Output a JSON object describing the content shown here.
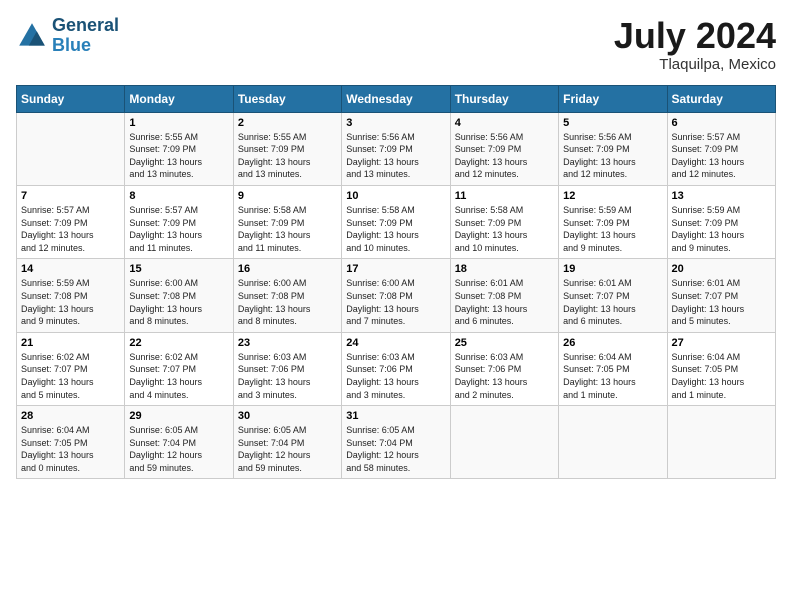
{
  "header": {
    "logo_line1": "General",
    "logo_line2": "Blue",
    "month": "July 2024",
    "location": "Tlaquilpa, Mexico"
  },
  "days_of_week": [
    "Sunday",
    "Monday",
    "Tuesday",
    "Wednesday",
    "Thursday",
    "Friday",
    "Saturday"
  ],
  "weeks": [
    [
      {
        "day": "",
        "info": ""
      },
      {
        "day": "1",
        "info": "Sunrise: 5:55 AM\nSunset: 7:09 PM\nDaylight: 13 hours\nand 13 minutes."
      },
      {
        "day": "2",
        "info": "Sunrise: 5:55 AM\nSunset: 7:09 PM\nDaylight: 13 hours\nand 13 minutes."
      },
      {
        "day": "3",
        "info": "Sunrise: 5:56 AM\nSunset: 7:09 PM\nDaylight: 13 hours\nand 13 minutes."
      },
      {
        "day": "4",
        "info": "Sunrise: 5:56 AM\nSunset: 7:09 PM\nDaylight: 13 hours\nand 12 minutes."
      },
      {
        "day": "5",
        "info": "Sunrise: 5:56 AM\nSunset: 7:09 PM\nDaylight: 13 hours\nand 12 minutes."
      },
      {
        "day": "6",
        "info": "Sunrise: 5:57 AM\nSunset: 7:09 PM\nDaylight: 13 hours\nand 12 minutes."
      }
    ],
    [
      {
        "day": "7",
        "info": "Sunrise: 5:57 AM\nSunset: 7:09 PM\nDaylight: 13 hours\nand 12 minutes."
      },
      {
        "day": "8",
        "info": "Sunrise: 5:57 AM\nSunset: 7:09 PM\nDaylight: 13 hours\nand 11 minutes."
      },
      {
        "day": "9",
        "info": "Sunrise: 5:58 AM\nSunset: 7:09 PM\nDaylight: 13 hours\nand 11 minutes."
      },
      {
        "day": "10",
        "info": "Sunrise: 5:58 AM\nSunset: 7:09 PM\nDaylight: 13 hours\nand 10 minutes."
      },
      {
        "day": "11",
        "info": "Sunrise: 5:58 AM\nSunset: 7:09 PM\nDaylight: 13 hours\nand 10 minutes."
      },
      {
        "day": "12",
        "info": "Sunrise: 5:59 AM\nSunset: 7:09 PM\nDaylight: 13 hours\nand 9 minutes."
      },
      {
        "day": "13",
        "info": "Sunrise: 5:59 AM\nSunset: 7:09 PM\nDaylight: 13 hours\nand 9 minutes."
      }
    ],
    [
      {
        "day": "14",
        "info": "Sunrise: 5:59 AM\nSunset: 7:08 PM\nDaylight: 13 hours\nand 9 minutes."
      },
      {
        "day": "15",
        "info": "Sunrise: 6:00 AM\nSunset: 7:08 PM\nDaylight: 13 hours\nand 8 minutes."
      },
      {
        "day": "16",
        "info": "Sunrise: 6:00 AM\nSunset: 7:08 PM\nDaylight: 13 hours\nand 8 minutes."
      },
      {
        "day": "17",
        "info": "Sunrise: 6:00 AM\nSunset: 7:08 PM\nDaylight: 13 hours\nand 7 minutes."
      },
      {
        "day": "18",
        "info": "Sunrise: 6:01 AM\nSunset: 7:08 PM\nDaylight: 13 hours\nand 6 minutes."
      },
      {
        "day": "19",
        "info": "Sunrise: 6:01 AM\nSunset: 7:07 PM\nDaylight: 13 hours\nand 6 minutes."
      },
      {
        "day": "20",
        "info": "Sunrise: 6:01 AM\nSunset: 7:07 PM\nDaylight: 13 hours\nand 5 minutes."
      }
    ],
    [
      {
        "day": "21",
        "info": "Sunrise: 6:02 AM\nSunset: 7:07 PM\nDaylight: 13 hours\nand 5 minutes."
      },
      {
        "day": "22",
        "info": "Sunrise: 6:02 AM\nSunset: 7:07 PM\nDaylight: 13 hours\nand 4 minutes."
      },
      {
        "day": "23",
        "info": "Sunrise: 6:03 AM\nSunset: 7:06 PM\nDaylight: 13 hours\nand 3 minutes."
      },
      {
        "day": "24",
        "info": "Sunrise: 6:03 AM\nSunset: 7:06 PM\nDaylight: 13 hours\nand 3 minutes."
      },
      {
        "day": "25",
        "info": "Sunrise: 6:03 AM\nSunset: 7:06 PM\nDaylight: 13 hours\nand 2 minutes."
      },
      {
        "day": "26",
        "info": "Sunrise: 6:04 AM\nSunset: 7:05 PM\nDaylight: 13 hours\nand 1 minute."
      },
      {
        "day": "27",
        "info": "Sunrise: 6:04 AM\nSunset: 7:05 PM\nDaylight: 13 hours\nand 1 minute."
      }
    ],
    [
      {
        "day": "28",
        "info": "Sunrise: 6:04 AM\nSunset: 7:05 PM\nDaylight: 13 hours\nand 0 minutes."
      },
      {
        "day": "29",
        "info": "Sunrise: 6:05 AM\nSunset: 7:04 PM\nDaylight: 12 hours\nand 59 minutes."
      },
      {
        "day": "30",
        "info": "Sunrise: 6:05 AM\nSunset: 7:04 PM\nDaylight: 12 hours\nand 59 minutes."
      },
      {
        "day": "31",
        "info": "Sunrise: 6:05 AM\nSunset: 7:04 PM\nDaylight: 12 hours\nand 58 minutes."
      },
      {
        "day": "",
        "info": ""
      },
      {
        "day": "",
        "info": ""
      },
      {
        "day": "",
        "info": ""
      }
    ]
  ]
}
